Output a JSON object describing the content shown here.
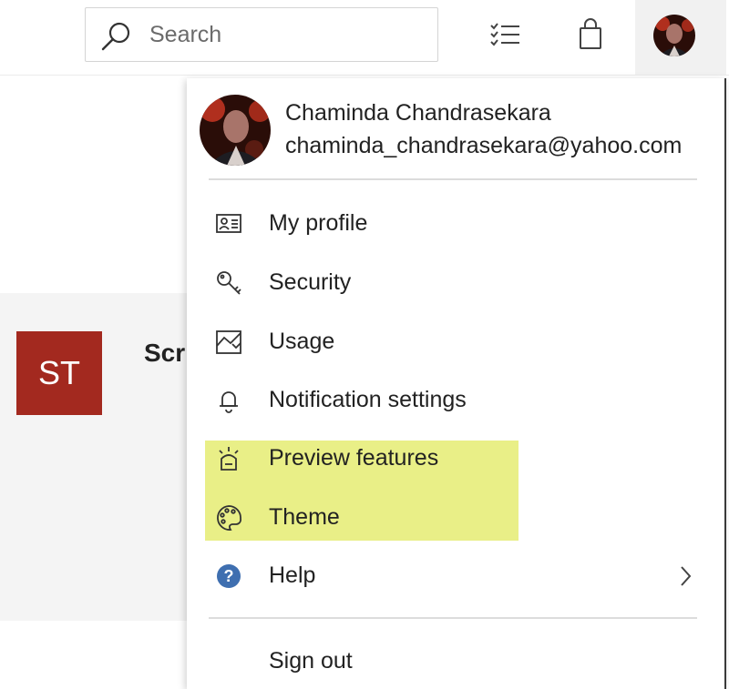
{
  "header": {
    "search": {
      "placeholder": "Search",
      "icon": "search-icon"
    },
    "icons": [
      "tasks-icon",
      "shopping-bag-icon",
      "avatar"
    ]
  },
  "site": {
    "tile_text": "ST",
    "tile_color": "#a3291f",
    "name_partial": "Scr"
  },
  "account_menu": {
    "user": {
      "name": "Chaminda Chandrasekara",
      "email": "chaminda_chandrasekara@yahoo.com"
    },
    "items": [
      {
        "label": "My profile",
        "icon": "contact-card-icon"
      },
      {
        "label": "Security",
        "icon": "key-icon"
      },
      {
        "label": "Usage",
        "icon": "usage-icon"
      },
      {
        "label": "Notification settings",
        "icon": "bell-icon"
      },
      {
        "label": "Preview features",
        "icon": "preview-features-icon",
        "highlighted": true
      },
      {
        "label": "Theme",
        "icon": "palette-icon",
        "highlighted": true
      },
      {
        "label": "Help",
        "icon": "help-icon",
        "has_submenu": true
      }
    ],
    "sign_out": {
      "label": "Sign out"
    },
    "highlight_color": "#e9ef87"
  }
}
